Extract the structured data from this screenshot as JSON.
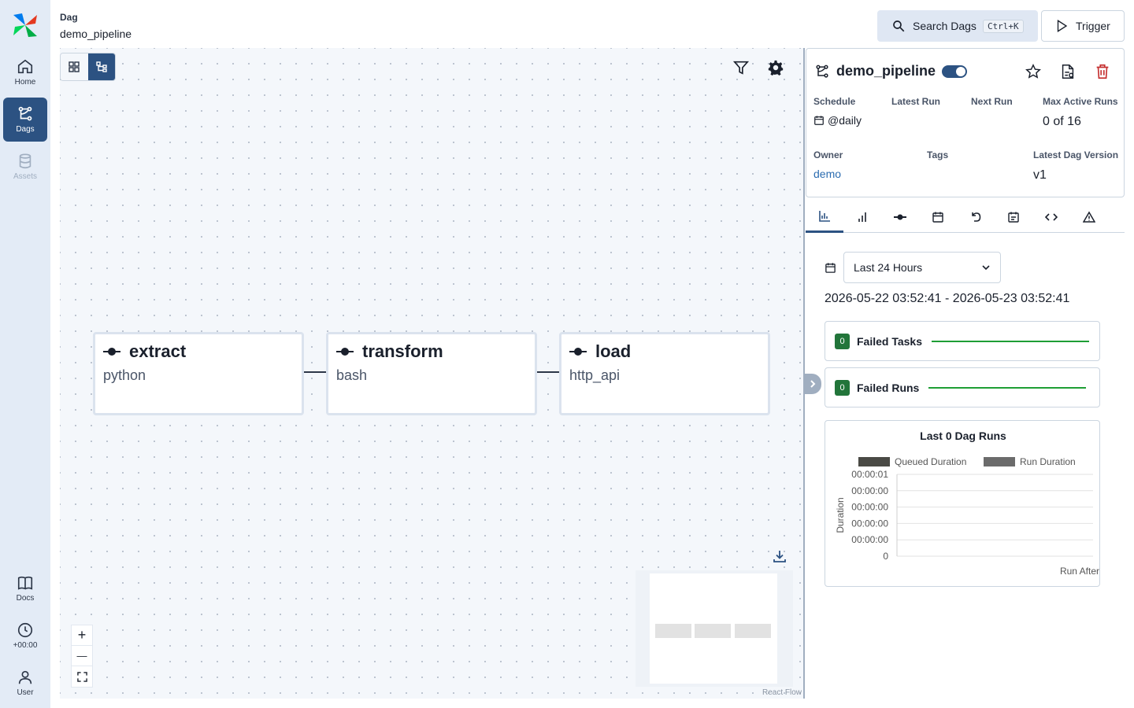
{
  "nav": {
    "logo": "airflow-pinwheel-logo",
    "items": [
      {
        "label": "Home",
        "icon": "home-icon"
      },
      {
        "label": "Dags",
        "icon": "dags-icon"
      },
      {
        "label": "Assets",
        "icon": "assets-icon"
      },
      {
        "label": "Docs",
        "icon": "book-icon"
      },
      {
        "label": "+00:00",
        "icon": "clock-icon"
      },
      {
        "label": "User",
        "icon": "user-icon"
      }
    ]
  },
  "header": {
    "crumb_type": "Dag",
    "crumb_name": "demo_pipeline",
    "search_label": "Search Dags",
    "search_shortcut": "Ctrl+K",
    "trigger_label": "Trigger"
  },
  "graph": {
    "nodes": [
      {
        "name": "extract",
        "operator": "python"
      },
      {
        "name": "transform",
        "operator": "bash"
      },
      {
        "name": "load",
        "operator": "http_api"
      }
    ],
    "attribution": "React Flow",
    "zoom_in": "+",
    "zoom_out": "—"
  },
  "dag": {
    "title": "demo_pipeline",
    "paused": false,
    "schedule_label": "Schedule",
    "schedule_value": "@daily",
    "latest_run_label": "Latest Run",
    "next_run_label": "Next Run",
    "max_active_label": "Max Active Runs",
    "max_active_value": "0 of 16",
    "owner_label": "Owner",
    "owner_value": "demo",
    "tags_label": "Tags",
    "version_label": "Latest Dag Version",
    "version_value": "v1"
  },
  "tabs": [
    "overview",
    "runs",
    "tasks",
    "calendar",
    "backfills",
    "audit-log",
    "code",
    "import-errors"
  ],
  "overview": {
    "range_select": "Last 24 Hours",
    "range_text": "2026-05-22 03:52:41 - 2026-05-23 03:52:41",
    "failed_tasks_label": "Failed Tasks",
    "failed_tasks_count": "0",
    "failed_runs_label": "Failed Runs",
    "failed_runs_count": "0"
  },
  "colors": {
    "accent": "#2c5282",
    "nav_bg": "#e3ebf6",
    "success": "#22753a",
    "spark": "#1e9e35",
    "danger": "#c53030"
  },
  "chart_data": {
    "type": "bar",
    "title": "Last 0 Dag Runs",
    "xlabel": "Run After",
    "ylabel": "Duration",
    "categories": [],
    "series": [
      {
        "name": "Queued Duration",
        "values": [],
        "color": "#4a4a45"
      },
      {
        "name": "Run Duration",
        "values": [],
        "color": "#6b6b6b"
      }
    ],
    "y_ticks": [
      "00:00:01",
      "00:00:00",
      "00:00:00",
      "00:00:00",
      "00:00:00",
      "0"
    ],
    "legend": "top",
    "grid": true
  }
}
